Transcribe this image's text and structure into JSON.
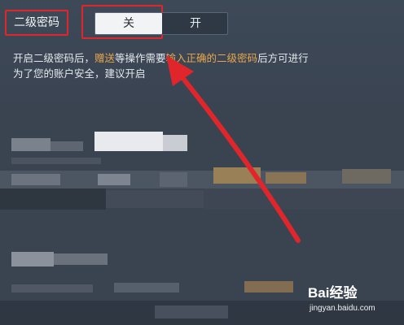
{
  "setting": {
    "label": "二级密码",
    "toggle_off": "关",
    "toggle_on": "开",
    "selected": "关"
  },
  "description": {
    "line1_a": "开启二级密码后，",
    "line1_b": "赠送",
    "line1_c": "等操作需要",
    "line1_d": "输入正确的二级密码",
    "line1_e": "后方可进行",
    "line2": "为了您的账户安全，建议开启"
  },
  "watermark": {
    "logo": "Bai经验",
    "url": "jingyan.baidu.com"
  },
  "colors": {
    "highlight": "#e8a84a",
    "annotation": "#e0262b",
    "background": "#36404d"
  }
}
